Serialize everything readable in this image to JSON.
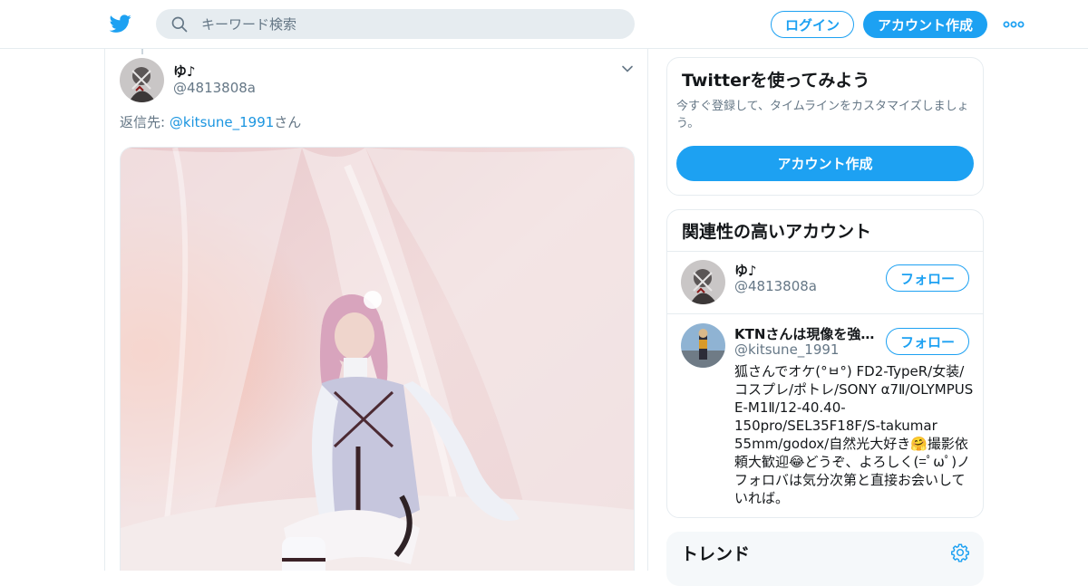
{
  "header": {
    "logo_icon": "twitter-bird-icon",
    "search": {
      "placeholder": "キーワード検索",
      "icon": "search-icon"
    },
    "login_label": "ログイン",
    "signup_label": "アカウント作成",
    "more_icon": "more-dots-icon"
  },
  "tweet": {
    "author": {
      "name": "ゆ♪",
      "handle": "@4813808a"
    },
    "menu_icon": "chevron-down-icon",
    "reply": {
      "prefix": "返信先: ",
      "mention": "@kitsune_1991",
      "suffix": "さん"
    }
  },
  "sidebar": {
    "signup_card": {
      "title": "Twitterを使ってみよう",
      "description": "今すぐ登録して、タイムラインをカスタマイズしましょう。",
      "button_label": "アカウント作成"
    },
    "related": {
      "title": "関連性の高いアカウント",
      "accounts": [
        {
          "name": "ゆ♪",
          "handle": "@4813808a",
          "follow_label": "フォロー"
        },
        {
          "name": "KTNさんは現像を強化中",
          "handle": "@kitsune_1991",
          "follow_label": "フォロー",
          "bio": "狐さんでオケ(°ㅂ°) FD2-TypeR/女装/コスプレ/ポトレ/SONY α7Ⅱ/OLYMPUS E-M1Ⅱ/12-40.40-150pro/SEL35F18F/S-takumar 55mm/godox/自然光大好き🤗撮影依頼大歓迎😂どうぞ、よろしく(=ﾟωﾟ)ノ フォロバは気分次第と直接お会いしていれば。"
        }
      ]
    },
    "trends": {
      "title": "トレンド",
      "settings_icon": "gear-icon"
    }
  },
  "colors": {
    "accent": "#1da1f2",
    "link": "#1b95e0",
    "muted": "#657786",
    "border": "#e6ecf0"
  }
}
